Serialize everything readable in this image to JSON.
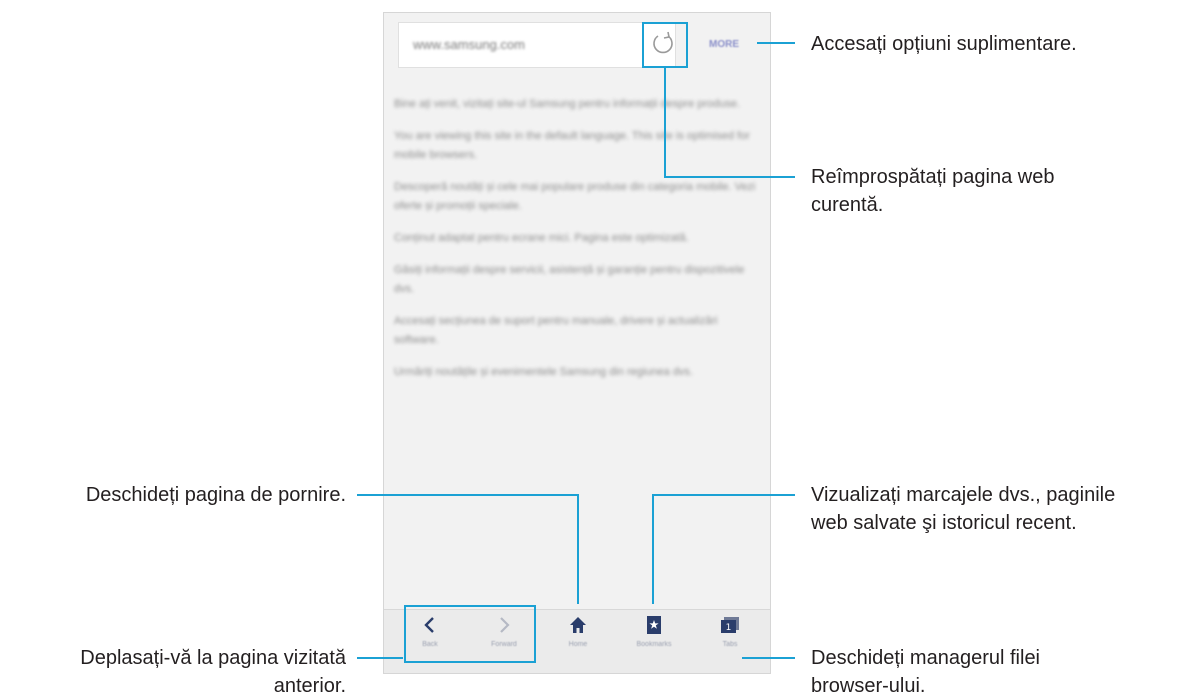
{
  "browser": {
    "url": "www.samsung.com",
    "more_label": "MORE",
    "paragraphs": [
      "Bine ați venit, vizitați site-ul Samsung pentru informații despre produse.",
      "You are viewing this site in the default language. This site is optimised for mobile browsers.",
      "Descoperă noutăți și cele mai populare produse din categoria mobile. Vezi oferte și promoții speciale.",
      "Conținut adaptat pentru ecrane mici. Pagina este optimizată.",
      "Găsiți informații despre servicii, asistență și garanție pentru dispozitivele dvs.",
      "Accesați secțiunea de suport pentru manuale, drivere și actualizări software.",
      "Urmăriți noutățile și evenimentele Samsung din regiunea dvs."
    ],
    "nav": {
      "back": "Back",
      "forward": "Forward",
      "home": "Home",
      "bookmarks": "Bookmarks",
      "tabs": "Tabs",
      "tab_count": "1"
    }
  },
  "callouts": {
    "more_options": "Accesați opțiuni suplimentare.",
    "refresh_line1": "Reîmprospătați pagina web",
    "refresh_line2": "curentă.",
    "home_page": "Deschideți pagina de pornire.",
    "bookmarks_line1": "Vizualizați marcajele dvs., paginile",
    "bookmarks_line2": "web salvate şi istoricul recent.",
    "back_line1": "Deplasați-vă la pagina vizitată",
    "back_line2": "anterior.",
    "tabs_line1": "Deschideți managerul filei",
    "tabs_line2": "browser-ului."
  },
  "colors": {
    "accent": "#1ba1d4",
    "nav_icon": "#2a3d6b"
  }
}
